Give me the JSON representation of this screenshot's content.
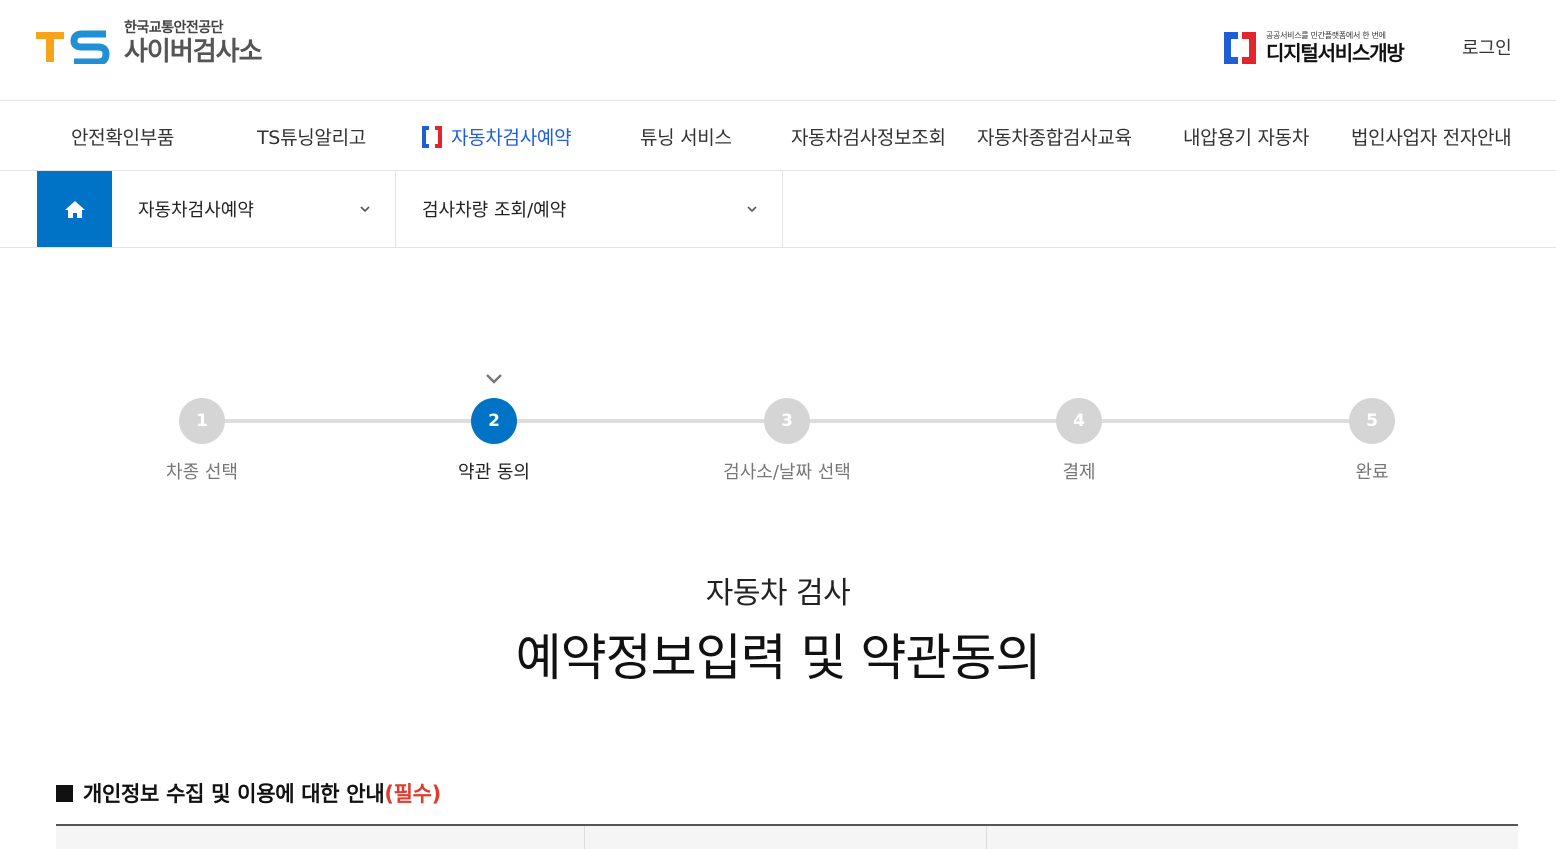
{
  "header": {
    "logo_mark": "TS",
    "logo_sub": "한국교통안전공단",
    "logo_main": "사이버검사소",
    "dsg_sub": "공공서비스를 민간플랫폼에서 한 번에",
    "dsg_main": "디지털서비스개방",
    "login": "로그인",
    "colors": {
      "ts_orange": "#f7a31c",
      "ts_blue": "#1f8fd6",
      "dsg_blue": "#1e5fd8",
      "dsg_red": "#e4252d"
    }
  },
  "gnb": {
    "items": [
      {
        "label": "안전확인부품"
      },
      {
        "label": "TS튜닝알리고"
      },
      {
        "label": "자동차검사예약"
      },
      {
        "label": "튜닝 서비스"
      },
      {
        "label": "자동차검사정보조회"
      },
      {
        "label": "자동차종합검사교육"
      },
      {
        "label": "내압용기 자동차"
      },
      {
        "label": "법인사업자 전자안내"
      }
    ],
    "active_color": "#1e5fd8"
  },
  "location": {
    "home_icon": "home-icon",
    "select1": "자동차검사예약",
    "select2": "검사차량 조회/예약",
    "home_color": "#0073c6"
  },
  "steps": {
    "items": [
      {
        "number": "1",
        "label": "차종 선택"
      },
      {
        "number": "2",
        "label": "약관 동의"
      },
      {
        "number": "3",
        "label": "검사소/날짜 선택"
      },
      {
        "number": "4",
        "label": "결제"
      },
      {
        "number": "5",
        "label": "완료"
      }
    ],
    "current": "2",
    "active_color": "#0073c6"
  },
  "titles": {
    "sub": "자동차 검사",
    "main": "예약정보입력 및 약관동의"
  },
  "section": {
    "title": "개인정보 수집 및 이용에 대한 안내",
    "required": "(필수)",
    "required_color": "#e03b2c"
  }
}
